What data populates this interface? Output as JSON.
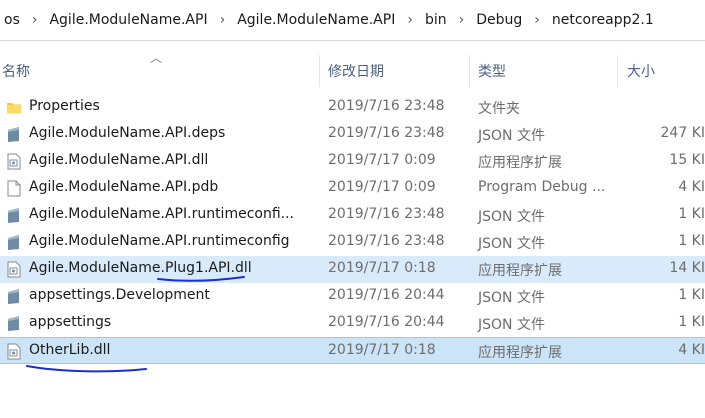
{
  "breadcrumb": [
    "os",
    "Agile.ModuleName.API",
    "Agile.ModuleName.API",
    "bin",
    "Debug",
    "netcoreapp2.1"
  ],
  "columns": {
    "name": "名称",
    "date": "修改日期",
    "type": "类型",
    "size": "大小"
  },
  "files": [
    {
      "name": "Properties",
      "date": "2019/7/16 23:48",
      "type": "文件夹",
      "size": "",
      "icon": "folder-icon"
    },
    {
      "name": "Agile.ModuleName.API.deps",
      "date": "2019/7/16 23:48",
      "type": "JSON 文件",
      "size": "247 KI",
      "icon": "json-file-icon"
    },
    {
      "name": "Agile.ModuleName.API.dll",
      "date": "2019/7/17 0:09",
      "type": "应用程序扩展",
      "size": "15 KI",
      "icon": "dll-file-icon"
    },
    {
      "name": "Agile.ModuleName.API.pdb",
      "date": "2019/7/17 0:09",
      "type": "Program Debug ...",
      "size": "4 KI",
      "icon": "blank-file-icon"
    },
    {
      "name": "Agile.ModuleName.API.runtimeconfi...",
      "date": "2019/7/16 23:48",
      "type": "JSON 文件",
      "size": "1 KI",
      "icon": "json-file-icon"
    },
    {
      "name": "Agile.ModuleName.API.runtimeconfig",
      "date": "2019/7/16 23:48",
      "type": "JSON 文件",
      "size": "1 KI",
      "icon": "json-file-icon"
    },
    {
      "name": "Agile.ModuleName.Plug1.API.dll",
      "date": "2019/7/17 0:18",
      "type": "应用程序扩展",
      "size": "14 KI",
      "icon": "dll-file-icon"
    },
    {
      "name": "appsettings.Development",
      "date": "2019/7/16 20:44",
      "type": "JSON 文件",
      "size": "1 KI",
      "icon": "json-file-icon"
    },
    {
      "name": "appsettings",
      "date": "2019/7/16 20:44",
      "type": "JSON 文件",
      "size": "1 KI",
      "icon": "json-file-icon"
    },
    {
      "name": "OtherLib.dll",
      "date": "2019/7/17 0:18",
      "type": "应用程序扩展",
      "size": "4 KI",
      "icon": "dll-file-icon"
    }
  ],
  "colors": {
    "selection_light": "#d9ebfa",
    "selection": "#cce4f7",
    "header_text": "#4d6082",
    "annotation_ink": "#1a2fd1"
  }
}
